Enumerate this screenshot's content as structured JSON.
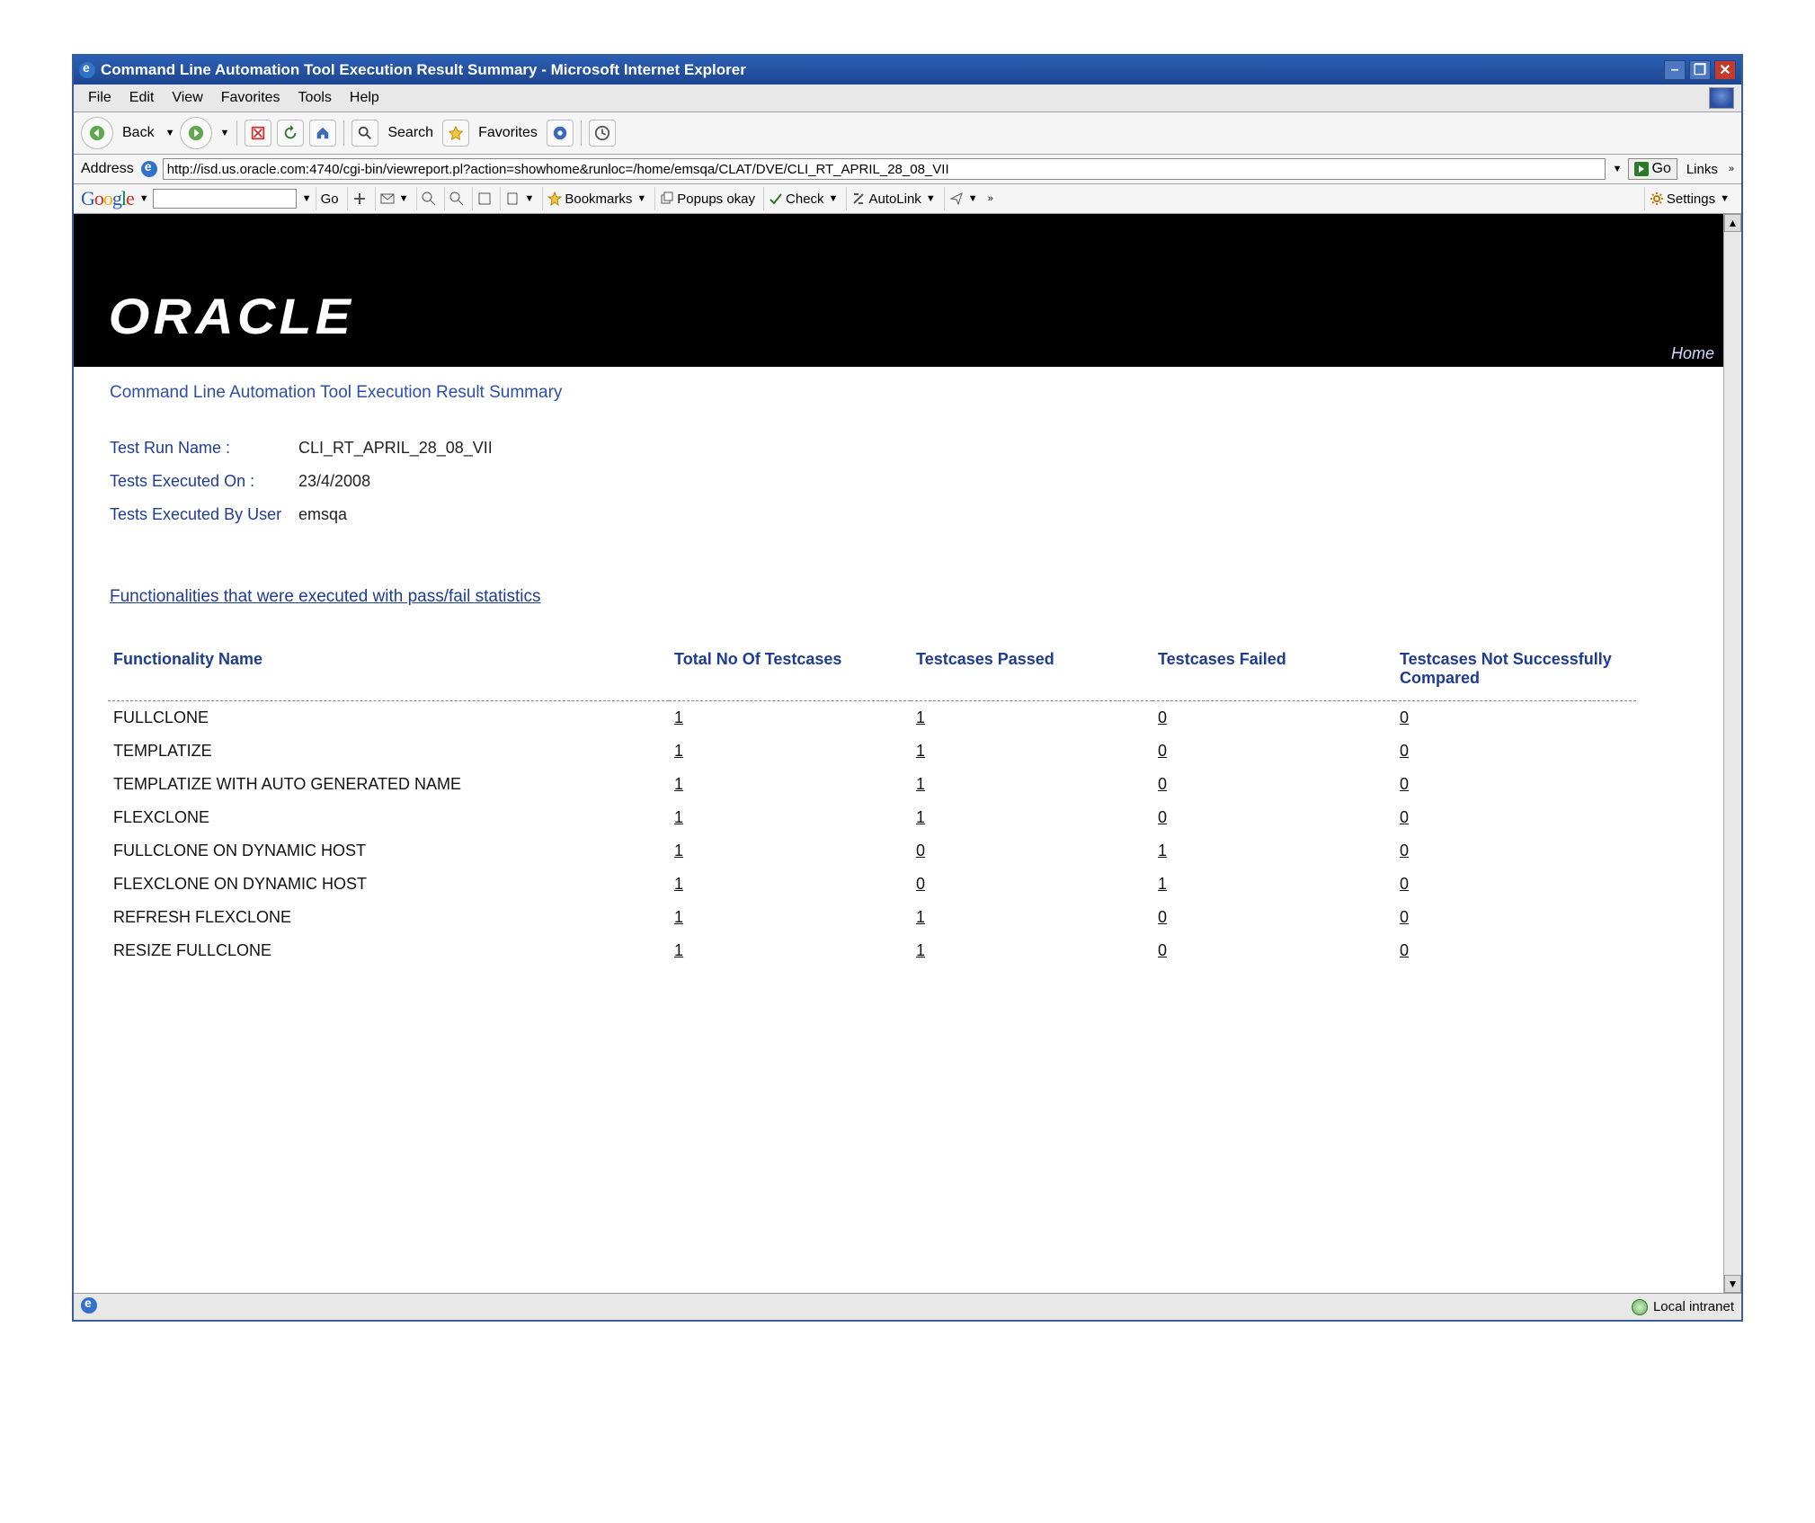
{
  "window": {
    "title": "Command Line Automation Tool Execution Result Summary - Microsoft Internet Explorer"
  },
  "menubar": {
    "items": [
      "File",
      "Edit",
      "View",
      "Favorites",
      "Tools",
      "Help"
    ]
  },
  "toolbar": {
    "back_label": "Back",
    "search_label": "Search",
    "favorites_label": "Favorites"
  },
  "addressbar": {
    "label": "Address",
    "url": "http://isd.us.oracle.com:4740/cgi-bin/viewreport.pl?action=showhome&runloc=/home/emsqa/CLAT/DVE/CLI_RT_APRIL_28_08_VII",
    "go_label": "Go",
    "links_label": "Links"
  },
  "google_toolbar": {
    "brand": "Google",
    "search_value": "",
    "items": [
      "Go",
      "Bookmarks",
      "Popups okay",
      "Check",
      "AutoLink"
    ],
    "settings_label": "Settings"
  },
  "oracle": {
    "logo_text": "ORACLE",
    "home_label": "Home"
  },
  "report": {
    "page_title": "Command Line Automation Tool Execution Result Summary",
    "labels": {
      "run_name": "Test Run Name :",
      "executed_on": "Tests Executed On :",
      "executed_by": "Tests Executed By User"
    },
    "values": {
      "run_name": "CLI_RT_APRIL_28_08_VII",
      "executed_on": "23/4/2008",
      "executed_by": "emsqa"
    },
    "func_heading": "Functionalities that were executed with pass/fail statistics"
  },
  "table": {
    "headers": {
      "name": "Functionality Name",
      "total": "Total No Of Testcases",
      "passed": "Testcases Passed",
      "failed": "Testcases Failed",
      "notcompared": "Testcases Not Successfully Compared"
    },
    "rows": [
      {
        "name": "FULLCLONE",
        "total": "1",
        "passed": "1",
        "failed": "0",
        "nc": "0"
      },
      {
        "name": "TEMPLATIZE",
        "total": "1",
        "passed": "1",
        "failed": "0",
        "nc": "0"
      },
      {
        "name": "TEMPLATIZE WITH AUTO GENERATED NAME",
        "total": "1",
        "passed": "1",
        "failed": "0",
        "nc": "0"
      },
      {
        "name": "FLEXCLONE",
        "total": "1",
        "passed": "1",
        "failed": "0",
        "nc": "0"
      },
      {
        "name": "FULLCLONE ON DYNAMIC HOST",
        "total": "1",
        "passed": "0",
        "failed": "1",
        "nc": "0"
      },
      {
        "name": "FLEXCLONE ON DYNAMIC HOST",
        "total": "1",
        "passed": "0",
        "failed": "1",
        "nc": "0"
      },
      {
        "name": "REFRESH FLEXCLONE",
        "total": "1",
        "passed": "1",
        "failed": "0",
        "nc": "0"
      },
      {
        "name": "RESIZE FULLCLONE",
        "total": "1",
        "passed": "1",
        "failed": "0",
        "nc": "0"
      }
    ]
  },
  "statusbar": {
    "left_text": "",
    "zone_label": "Local intranet"
  }
}
